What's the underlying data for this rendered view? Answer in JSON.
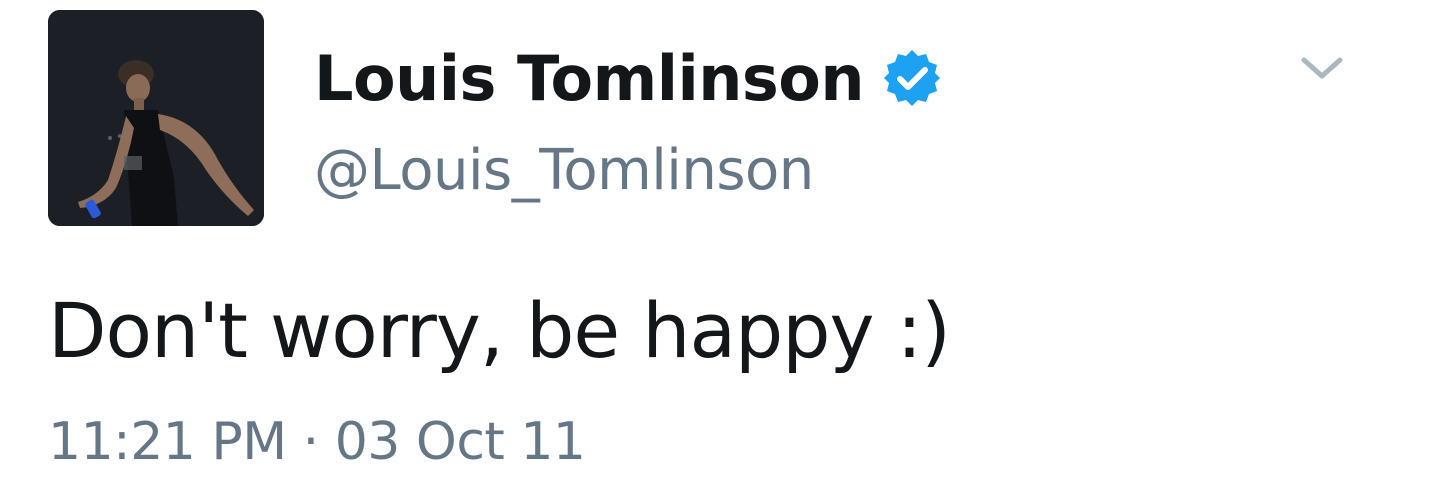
{
  "tweet": {
    "display_name": "Louis Tomlinson",
    "handle": "@Louis_Tomlinson",
    "verified": true,
    "text": "Don't worry, be happy :)",
    "timestamp": "11:21 PM · 03 Oct 11"
  },
  "icons": {
    "verified": "verified-badge-icon",
    "menu": "chevron-down-icon"
  },
  "colors": {
    "name": "#14171a",
    "secondary": "#657786",
    "verified": "#1da1f2",
    "chevron": "#aab8c2"
  }
}
